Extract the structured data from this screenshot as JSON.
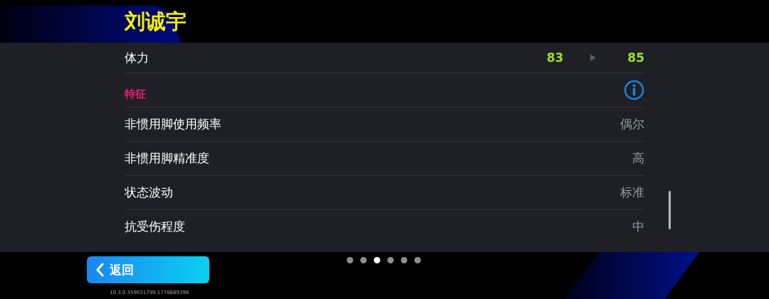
{
  "player_name": "刘诚宇",
  "stat": {
    "label": "体力",
    "current": "83",
    "next": "85"
  },
  "section": {
    "title": "特征"
  },
  "traits": [
    {
      "label": "非惯用脚使用频率",
      "value": "偶尔"
    },
    {
      "label": "非惯用脚精准度",
      "value": "高"
    },
    {
      "label": "状态波动",
      "value": "标准"
    },
    {
      "label": "抗受伤程度",
      "value": "中"
    }
  ],
  "pages": [
    {
      "selected": false
    },
    {
      "selected": false
    },
    {
      "selected": true
    },
    {
      "selected": false
    },
    {
      "selected": false
    },
    {
      "selected": false
    }
  ],
  "back_button": {
    "label": "返回"
  },
  "version": "10.3.0.359031799.1776689396"
}
